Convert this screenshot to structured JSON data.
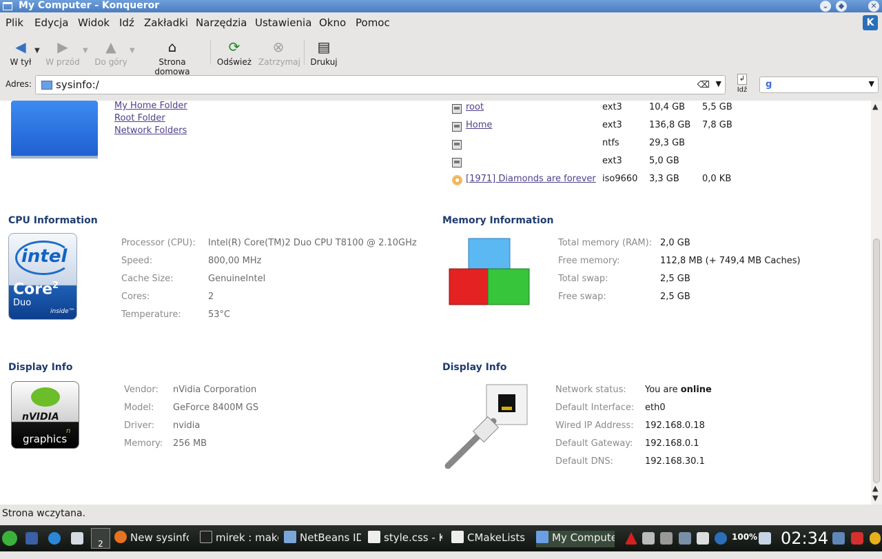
{
  "window": {
    "title": "My Computer - Konqueror"
  },
  "menu": [
    "Plik",
    "Edycja",
    "Widok",
    "Idź",
    "Zakładki",
    "Narzędzia",
    "Ustawienia",
    "Okno",
    "Pomoc"
  ],
  "toolbar": {
    "back": "W tył",
    "forward": "W przód",
    "up": "Do góry",
    "home": "Strona domowa",
    "reload": "Odśwież",
    "stop": "Zatrzymaj",
    "print": "Drukuj"
  },
  "address": {
    "label": "Adres:",
    "value": "sysinfo:/",
    "go": "Idź"
  },
  "places": [
    "My Home Folder",
    "Root Folder",
    "Network Folders"
  ],
  "drives": [
    {
      "name": "root",
      "fs": "ext3",
      "size": "10,4 GB",
      "free": "5,5 GB",
      "icon": "hdd-icon"
    },
    {
      "name": "Home",
      "fs": "ext3",
      "size": "136,8 GB",
      "free": "7,8 GB",
      "icon": "hdd-icon"
    },
    {
      "name": "",
      "fs": "ntfs",
      "size": "29,3 GB",
      "free": "",
      "icon": "hdd-icon"
    },
    {
      "name": "",
      "fs": "ext3",
      "size": "5,0 GB",
      "free": "",
      "icon": "hdd-icon"
    },
    {
      "name": "[1971] Diamonds are forever",
      "fs": "iso9660",
      "size": "3,3 GB",
      "free": "0,0 KB",
      "icon": "cdrom-icon"
    }
  ],
  "cpu": {
    "title": "CPU Information",
    "logo": {
      "brand": "intel",
      "line1": "Core",
      "line1_sup": "2",
      "line2": "Duo",
      "line3": "inside™"
    },
    "rows": [
      {
        "label": "Processor (CPU):",
        "value": "Intel(R) Core(TM)2 Duo CPU T8100 @ 2.10GHz"
      },
      {
        "label": "Speed:",
        "value": "800,00 MHz"
      },
      {
        "label": "Cache Size:",
        "value": "GenuineIntel"
      },
      {
        "label": "Cores:",
        "value": "2"
      },
      {
        "label": "Temperature:",
        "value": "53°C"
      }
    ]
  },
  "memory": {
    "title": "Memory Information",
    "rows": [
      {
        "label": "Total memory (RAM):",
        "value": "2,0 GB"
      },
      {
        "label": "Free memory:",
        "value": "112,8 MB (+ 749,4 MB Caches)"
      },
      {
        "label": "Total swap:",
        "value": "2,5 GB"
      },
      {
        "label": "Free swap:",
        "value": "2,5 GB"
      }
    ]
  },
  "display": {
    "title": "Display Info",
    "logo": {
      "brand": "nVIDIA",
      "sub": "graphics",
      "sup": "n"
    },
    "rows": [
      {
        "label": "Vendor:",
        "value": "nVidia Corporation"
      },
      {
        "label": "Model:",
        "value": "GeForce 8400M GS"
      },
      {
        "label": "Driver:",
        "value": "nvidia"
      },
      {
        "label": "Memory:",
        "value": "256 MB"
      }
    ]
  },
  "network": {
    "title": "Display Info",
    "status_label": "Network status:",
    "status_prefix": "You are ",
    "status_word": "online",
    "rows": [
      {
        "label": "Default Interface:",
        "value": "eth0"
      },
      {
        "label": "Wired IP Address:",
        "value": "192.168.0.18"
      },
      {
        "label": "Default Gateway:",
        "value": "192.168.0.1"
      },
      {
        "label": "Default DNS:",
        "value": "192.168.30.1"
      }
    ]
  },
  "status": "Strona wczytana.",
  "taskbar": {
    "desktop_number": "2",
    "tasks": [
      "New sysinfo",
      "mirek : make",
      "NetBeans ID",
      "style.css - K",
      "CMakeLists",
      "My Compute"
    ],
    "battery": "100%",
    "clock": "02:34"
  },
  "colors": {
    "titlebar": "#4a7dc2",
    "section_title": "#1f3c6e",
    "link": "#4f3f8a",
    "taskbar": "#1a1e1a"
  }
}
